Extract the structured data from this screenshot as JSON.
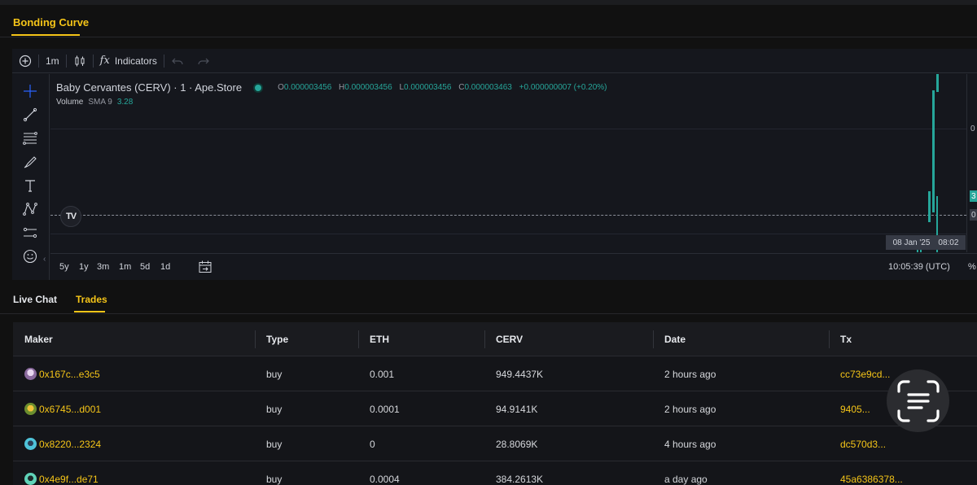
{
  "bonding_tab": {
    "label": "Bonding Curve"
  },
  "chart_toolbar": {
    "interval": "1m",
    "indicators_label": "Indicators",
    "fx_label": "fx"
  },
  "chart": {
    "symbol_title": "Baby Cervantes (CERV) · 1 · Ape.Store",
    "ohlc": {
      "o_label": "O",
      "o": "0.000003456",
      "h_label": "H",
      "h": "0.000003456",
      "l_label": "L",
      "l": "0.000003456",
      "c_label": "C",
      "c": "0.000003463",
      "change": "+0.000000007 (+0.20%)"
    },
    "volume_label": "Volume",
    "sma_label": "SMA 9",
    "sma_value": "3.28",
    "axis_tick_mid": "0",
    "axis_tick_low": "0",
    "price_tag_label": "3",
    "crosshair_date": "08 Jan '25",
    "crosshair_time": "08:02",
    "logo_text": "TV",
    "colors": {
      "up": "#26a69a",
      "accent": "#f5c518",
      "panel": "#15171d"
    }
  },
  "ranges": [
    "5y",
    "1y",
    "3m",
    "1m",
    "5d",
    "1d"
  ],
  "clock": "10:05:39 (UTC)",
  "percent_toggle": "%",
  "bottom_tabs": {
    "live_chat": "Live Chat",
    "trades": "Trades"
  },
  "trades": {
    "headers": {
      "maker": "Maker",
      "type": "Type",
      "eth": "ETH",
      "cerv": "CERV",
      "date": "Date",
      "tx": "Tx"
    },
    "rows": [
      {
        "maker": "0x167c...e3c5",
        "type": "buy",
        "eth": "0.001",
        "cerv": "949.4437K",
        "date": "2 hours ago",
        "tx": "cc73e9cd..."
      },
      {
        "maker": "0x6745...d001",
        "type": "buy",
        "eth": "0.0001",
        "cerv": "94.9141K",
        "date": "2 hours ago",
        "tx": "9405..."
      },
      {
        "maker": "0x8220...2324",
        "type": "buy",
        "eth": "0",
        "cerv": "28.8069K",
        "date": "4 hours ago",
        "tx": "dc570d3..."
      },
      {
        "maker": "0x4e9f...de71",
        "type": "buy",
        "eth": "0.0004",
        "cerv": "384.2613K",
        "date": "a day ago",
        "tx": "45a6386378..."
      }
    ]
  },
  "icons": {
    "add": "add-circle-icon",
    "candles": "candlestick-icon",
    "undo": "undo-icon",
    "redo": "redo-icon",
    "crosshair": "crosshair-icon",
    "trendline": "trend-line-icon",
    "fib": "fib-lines-icon",
    "brush": "brush-icon",
    "text": "text-icon",
    "pattern": "pattern-icon",
    "measure": "measure-icon",
    "emoji": "emoji-icon",
    "calendar": "calendar-range-icon",
    "scan": "scan-text-icon"
  }
}
